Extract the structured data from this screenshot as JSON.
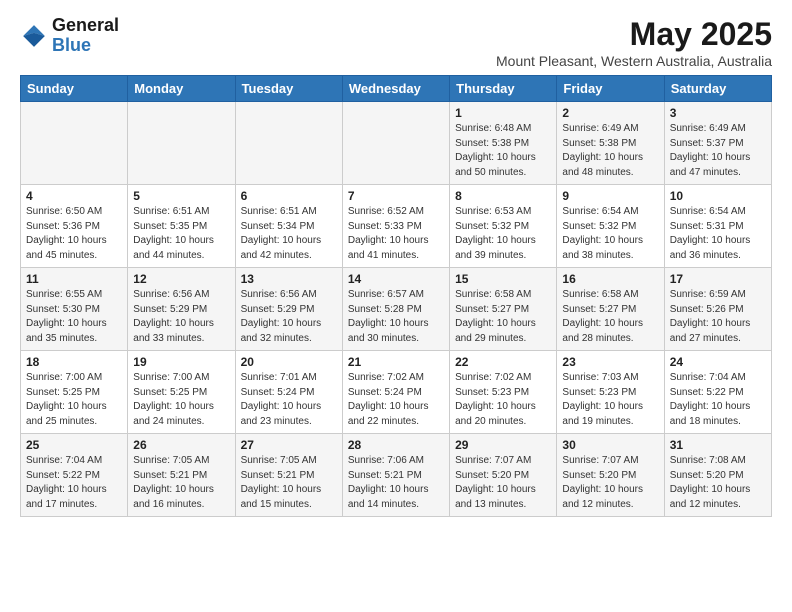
{
  "header": {
    "logo_general": "General",
    "logo_blue": "Blue",
    "month": "May 2025",
    "location": "Mount Pleasant, Western Australia, Australia"
  },
  "days_of_week": [
    "Sunday",
    "Monday",
    "Tuesday",
    "Wednesday",
    "Thursday",
    "Friday",
    "Saturday"
  ],
  "weeks": [
    [
      {
        "num": "",
        "info": ""
      },
      {
        "num": "",
        "info": ""
      },
      {
        "num": "",
        "info": ""
      },
      {
        "num": "",
        "info": ""
      },
      {
        "num": "1",
        "info": "Sunrise: 6:48 AM\nSunset: 5:38 PM\nDaylight: 10 hours\nand 50 minutes."
      },
      {
        "num": "2",
        "info": "Sunrise: 6:49 AM\nSunset: 5:38 PM\nDaylight: 10 hours\nand 48 minutes."
      },
      {
        "num": "3",
        "info": "Sunrise: 6:49 AM\nSunset: 5:37 PM\nDaylight: 10 hours\nand 47 minutes."
      }
    ],
    [
      {
        "num": "4",
        "info": "Sunrise: 6:50 AM\nSunset: 5:36 PM\nDaylight: 10 hours\nand 45 minutes."
      },
      {
        "num": "5",
        "info": "Sunrise: 6:51 AM\nSunset: 5:35 PM\nDaylight: 10 hours\nand 44 minutes."
      },
      {
        "num": "6",
        "info": "Sunrise: 6:51 AM\nSunset: 5:34 PM\nDaylight: 10 hours\nand 42 minutes."
      },
      {
        "num": "7",
        "info": "Sunrise: 6:52 AM\nSunset: 5:33 PM\nDaylight: 10 hours\nand 41 minutes."
      },
      {
        "num": "8",
        "info": "Sunrise: 6:53 AM\nSunset: 5:32 PM\nDaylight: 10 hours\nand 39 minutes."
      },
      {
        "num": "9",
        "info": "Sunrise: 6:54 AM\nSunset: 5:32 PM\nDaylight: 10 hours\nand 38 minutes."
      },
      {
        "num": "10",
        "info": "Sunrise: 6:54 AM\nSunset: 5:31 PM\nDaylight: 10 hours\nand 36 minutes."
      }
    ],
    [
      {
        "num": "11",
        "info": "Sunrise: 6:55 AM\nSunset: 5:30 PM\nDaylight: 10 hours\nand 35 minutes."
      },
      {
        "num": "12",
        "info": "Sunrise: 6:56 AM\nSunset: 5:29 PM\nDaylight: 10 hours\nand 33 minutes."
      },
      {
        "num": "13",
        "info": "Sunrise: 6:56 AM\nSunset: 5:29 PM\nDaylight: 10 hours\nand 32 minutes."
      },
      {
        "num": "14",
        "info": "Sunrise: 6:57 AM\nSunset: 5:28 PM\nDaylight: 10 hours\nand 30 minutes."
      },
      {
        "num": "15",
        "info": "Sunrise: 6:58 AM\nSunset: 5:27 PM\nDaylight: 10 hours\nand 29 minutes."
      },
      {
        "num": "16",
        "info": "Sunrise: 6:58 AM\nSunset: 5:27 PM\nDaylight: 10 hours\nand 28 minutes."
      },
      {
        "num": "17",
        "info": "Sunrise: 6:59 AM\nSunset: 5:26 PM\nDaylight: 10 hours\nand 27 minutes."
      }
    ],
    [
      {
        "num": "18",
        "info": "Sunrise: 7:00 AM\nSunset: 5:25 PM\nDaylight: 10 hours\nand 25 minutes."
      },
      {
        "num": "19",
        "info": "Sunrise: 7:00 AM\nSunset: 5:25 PM\nDaylight: 10 hours\nand 24 minutes."
      },
      {
        "num": "20",
        "info": "Sunrise: 7:01 AM\nSunset: 5:24 PM\nDaylight: 10 hours\nand 23 minutes."
      },
      {
        "num": "21",
        "info": "Sunrise: 7:02 AM\nSunset: 5:24 PM\nDaylight: 10 hours\nand 22 minutes."
      },
      {
        "num": "22",
        "info": "Sunrise: 7:02 AM\nSunset: 5:23 PM\nDaylight: 10 hours\nand 20 minutes."
      },
      {
        "num": "23",
        "info": "Sunrise: 7:03 AM\nSunset: 5:23 PM\nDaylight: 10 hours\nand 19 minutes."
      },
      {
        "num": "24",
        "info": "Sunrise: 7:04 AM\nSunset: 5:22 PM\nDaylight: 10 hours\nand 18 minutes."
      }
    ],
    [
      {
        "num": "25",
        "info": "Sunrise: 7:04 AM\nSunset: 5:22 PM\nDaylight: 10 hours\nand 17 minutes."
      },
      {
        "num": "26",
        "info": "Sunrise: 7:05 AM\nSunset: 5:21 PM\nDaylight: 10 hours\nand 16 minutes."
      },
      {
        "num": "27",
        "info": "Sunrise: 7:05 AM\nSunset: 5:21 PM\nDaylight: 10 hours\nand 15 minutes."
      },
      {
        "num": "28",
        "info": "Sunrise: 7:06 AM\nSunset: 5:21 PM\nDaylight: 10 hours\nand 14 minutes."
      },
      {
        "num": "29",
        "info": "Sunrise: 7:07 AM\nSunset: 5:20 PM\nDaylight: 10 hours\nand 13 minutes."
      },
      {
        "num": "30",
        "info": "Sunrise: 7:07 AM\nSunset: 5:20 PM\nDaylight: 10 hours\nand 12 minutes."
      },
      {
        "num": "31",
        "info": "Sunrise: 7:08 AM\nSunset: 5:20 PM\nDaylight: 10 hours\nand 12 minutes."
      }
    ]
  ]
}
